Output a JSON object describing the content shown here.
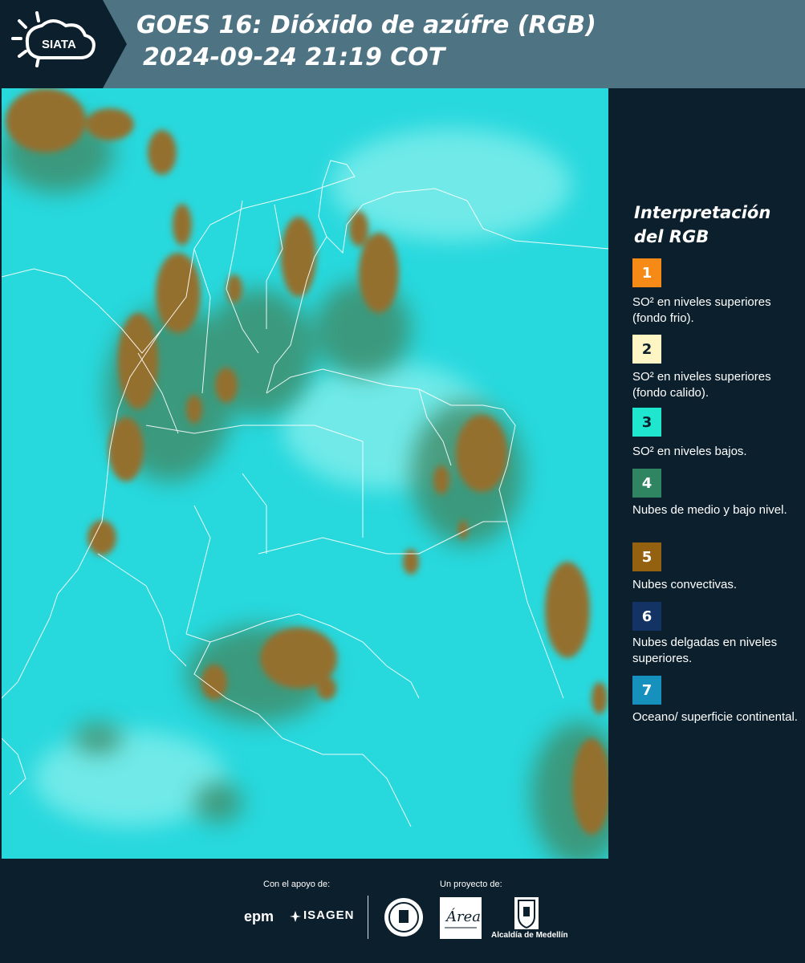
{
  "header": {
    "logo_text": "SIATA",
    "title_line1": "GOES 16: Dióxido de azúfre (RGB)",
    "title_line2": "2024-09-24 21:19 COT",
    "background_color": "#4e7383"
  },
  "map": {
    "ocean_color": "#27d8dd",
    "cloud_color": "#94702f",
    "green_cloud_color": "#3f8a66",
    "border_color": "#ffffff"
  },
  "legend": {
    "title": "Interpretación del RGB",
    "items": [
      {
        "number": "1",
        "color": "#f58a16",
        "text_color": "#ffffff",
        "description": "SO² en niveles superiores (fondo frio)."
      },
      {
        "number": "2",
        "color": "#fdf6c4",
        "text_color": "#0c1f2c",
        "description": "SO² en niveles superiores (fondo calido)."
      },
      {
        "number": "3",
        "color": "#1ee6cf",
        "text_color": "#0c1f2c",
        "description": "SO² en niveles bajos."
      },
      {
        "number": "4",
        "color": "#2f8462",
        "text_color": "#ffffff",
        "description": "Nubes de medio y bajo nivel."
      },
      {
        "number": "5",
        "color": "#946111",
        "text_color": "#ffffff",
        "description": "Nubes convectivas."
      },
      {
        "number": "6",
        "color": "#123363",
        "text_color": "#ffffff",
        "description": "Nubes delgadas en niveles superiores."
      },
      {
        "number": "7",
        "color": "#1691be",
        "text_color": "#ffffff",
        "description": "Oceano/ superficie continental."
      }
    ]
  },
  "footer": {
    "support_label": "Con el apoyo de:",
    "project_label": "Un proyecto de:",
    "epm": "epm",
    "isagen": "ISAGEN",
    "alcaldia": "Alcaldía de Medellín"
  }
}
